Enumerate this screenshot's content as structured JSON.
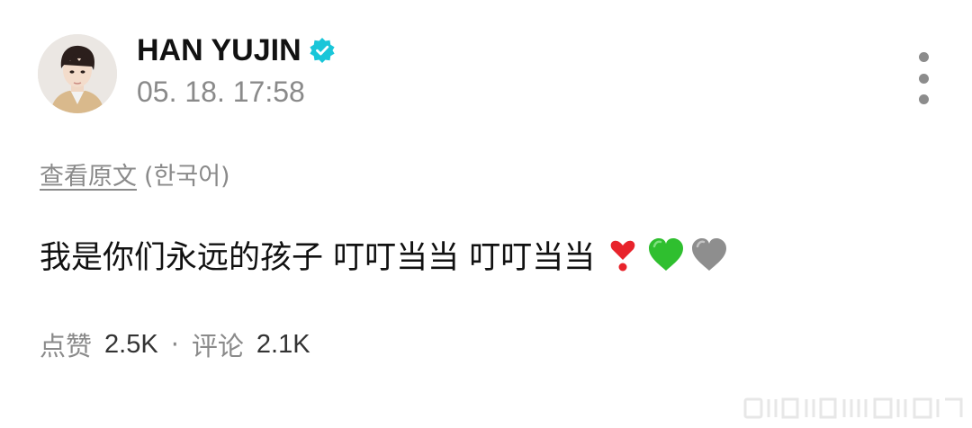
{
  "post": {
    "author": "HAN YUJIN",
    "verified_icon": "verified-badge-icon",
    "timestamp": "05. 18. 17:58",
    "more_icon": "more-vertical-icon",
    "view_original_label": "查看原文",
    "original_language": "(한국어)",
    "text": "我是你们永远的孩子 叮叮当当 叮叮当当",
    "emojis": [
      "heart-exclamation-icon",
      "green-heart-icon",
      "grey-heart-icon"
    ]
  },
  "stats": {
    "likes_label": "点赞",
    "likes_count": "2.5K",
    "separator": "·",
    "comments_label": "评论",
    "comments_count": "2.1K"
  },
  "colors": {
    "verified": "#19c6d9",
    "secondary_text": "#8a8a8a",
    "green_heart": "#2fbf2f",
    "grey_heart": "#8e8e8e",
    "red_mark": "#e8232b"
  }
}
